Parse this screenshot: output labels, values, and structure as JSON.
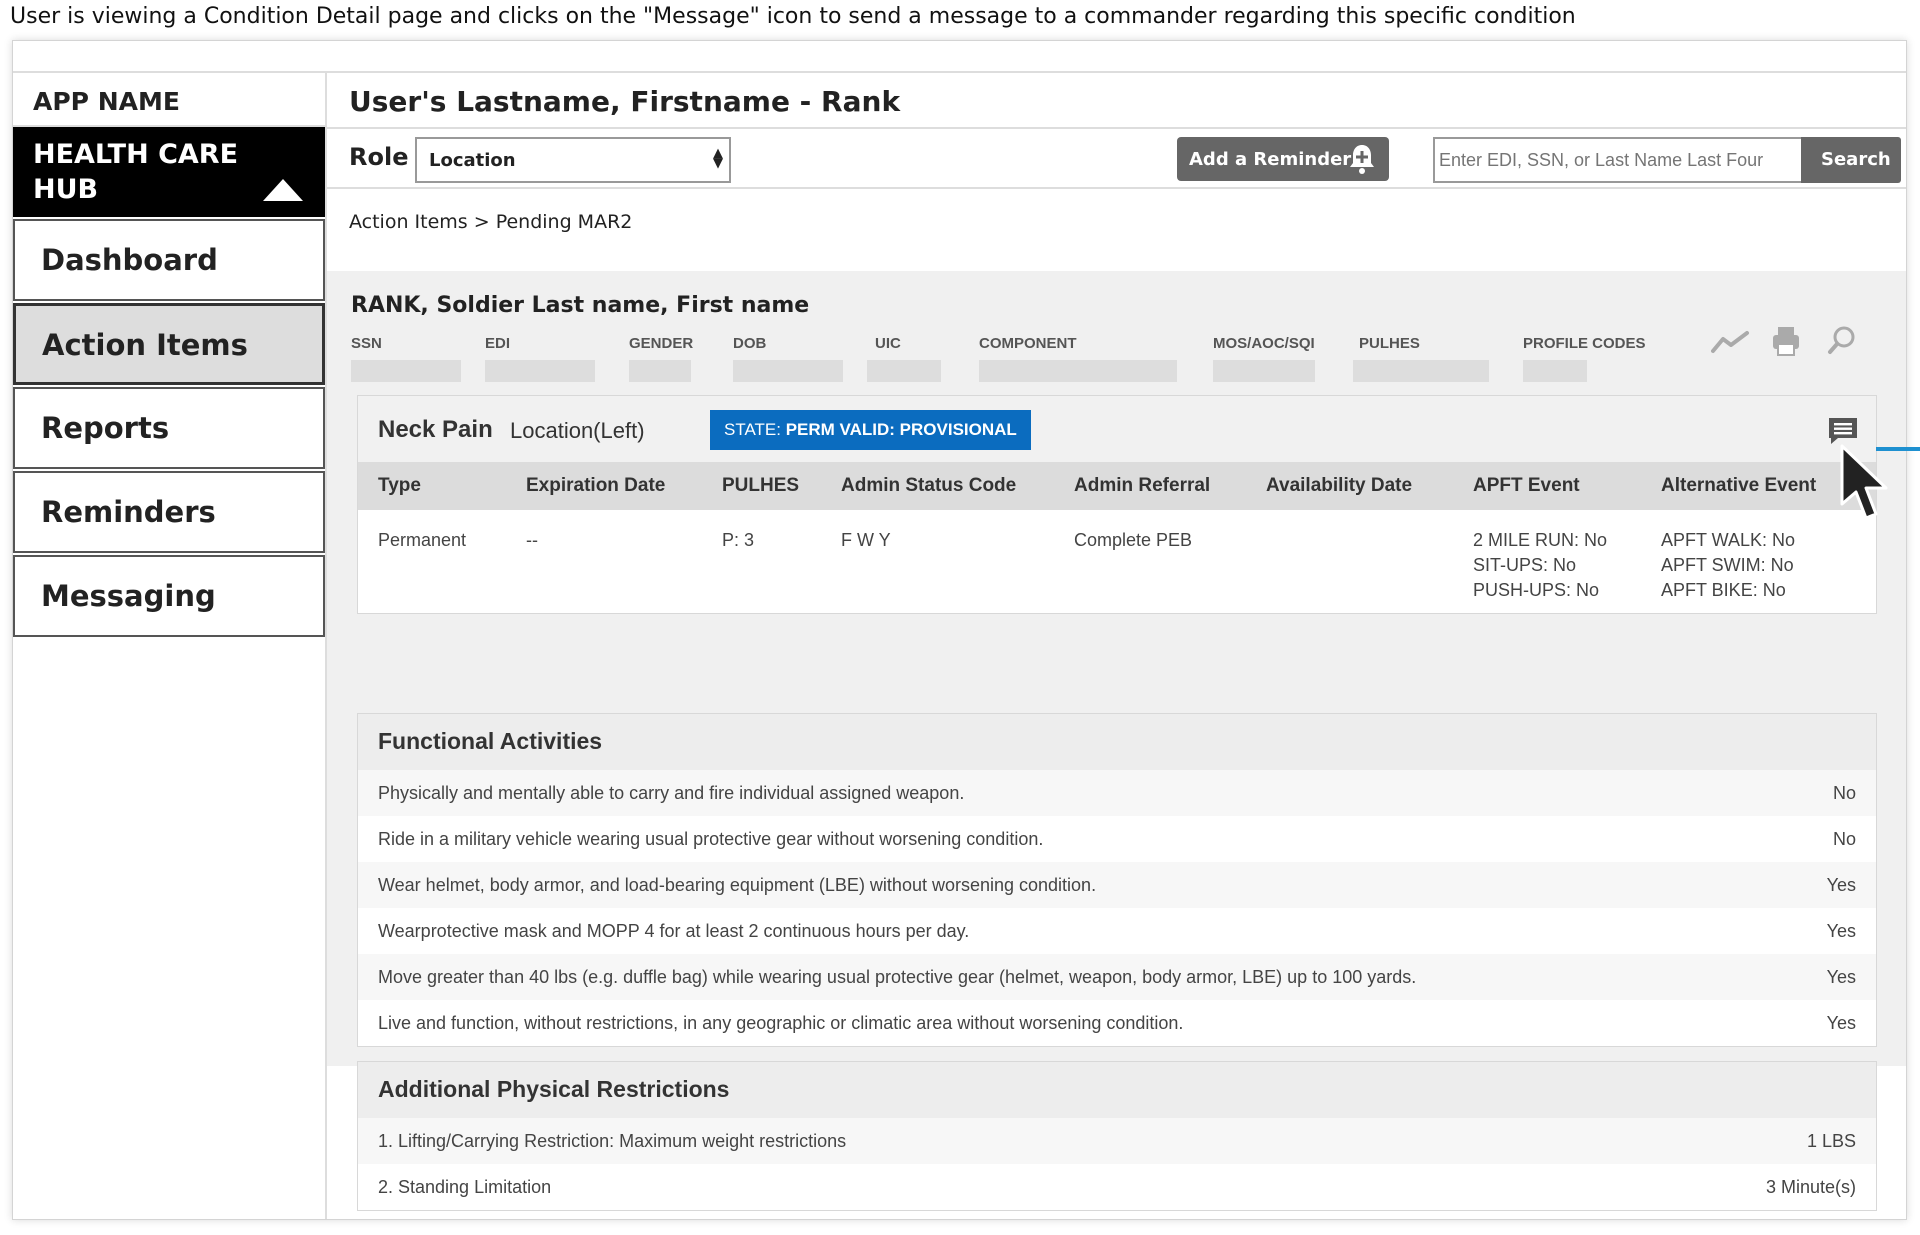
{
  "caption": "User is viewing a Condition Detail page and clicks on the \"Message\" icon to send a message to a commander regarding this specific condition",
  "sidebar": {
    "app_name": "APP NAME",
    "hub_title": "HEALTH CARE HUB",
    "items": [
      {
        "label": "Dashboard"
      },
      {
        "label": "Action Items"
      },
      {
        "label": "Reports"
      },
      {
        "label": "Reminders"
      },
      {
        "label": "Messaging"
      }
    ]
  },
  "header": {
    "user_title": "User's Lastname, Firstname - Rank",
    "role_label": "Role",
    "location_select": "Location",
    "add_reminder": "Add a Reminder",
    "search_placeholder": "Enter EDI, SSN, or Last Name Last Four",
    "search_button": "Search"
  },
  "breadcrumb": "Action Items > Pending MAR2",
  "soldier": {
    "name": "RANK, Soldier Last name, First name",
    "fields": [
      "SSN",
      "EDI",
      "GENDER",
      "DOB",
      "UIC",
      "COMPONENT",
      "MOS/AOC/SQI",
      "PULHES",
      "PROFILE CODES"
    ]
  },
  "condition": {
    "name": "Neck Pain",
    "location": "Location(Left)",
    "state_prefix": "STATE: ",
    "state_value": "PERM VALID: PROVISIONAL",
    "columns": [
      "Type",
      "Expiration Date",
      "PULHES",
      "Admin Status Code",
      "Admin Referral",
      "Availability Date",
      "APFT Event",
      "Alternative Event"
    ],
    "row": {
      "type": "Permanent",
      "expiration": "--",
      "pulhes": "P: 3",
      "admin_status": "F W Y",
      "admin_referral": "Complete PEB",
      "availability": "",
      "apft": [
        "2 MILE RUN: No",
        "SIT-UPS: No",
        "PUSH-UPS: No"
      ],
      "alternative": [
        "APFT WALK: No",
        "APFT SWIM: No",
        "APFT BIKE: No"
      ]
    }
  },
  "functional": {
    "title": "Functional Activities",
    "rows": [
      {
        "text": "Physically and mentally able to carry and fire individual assigned weapon.",
        "answer": "No"
      },
      {
        "text": "Ride in a military vehicle wearing usual protective gear without worsening condition.",
        "answer": "No"
      },
      {
        "text": "Wear helmet, body armor, and load-bearing equipment (LBE) without worsening condition.",
        "answer": "Yes"
      },
      {
        "text": "Wearprotective mask and MOPP 4 for at least 2 continuous hours per day.",
        "answer": "Yes"
      },
      {
        "text": "Move greater than 40 lbs (e.g. duffle bag) while wearing usual protective gear (helmet, weapon, body armor, LBE) up to 100 yards.",
        "answer": "Yes"
      },
      {
        "text": "Live and function, without restrictions, in any geographic or climatic area without worsening condition.",
        "answer": "Yes"
      }
    ]
  },
  "restrictions": {
    "title": "Additional Physical Restrictions",
    "rows": [
      {
        "text": "1. Lifting/Carrying Restriction: Maximum weight restrictions",
        "answer": "1 LBS"
      },
      {
        "text": "2. Standing Limitation",
        "answer": "3 Minute(s)"
      }
    ]
  },
  "icons": {
    "trend": "trend-icon",
    "print": "print-icon",
    "search": "search-icon",
    "message": "message-icon",
    "bell": "bell-plus-icon"
  },
  "colors": {
    "state_badge": "#0b6cbf",
    "pointer_line": "#1e90d0"
  }
}
